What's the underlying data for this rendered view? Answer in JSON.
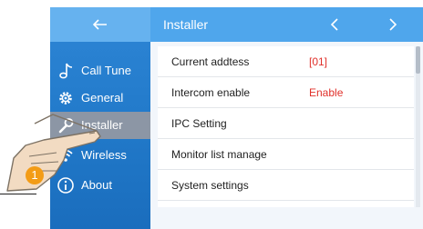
{
  "sidebar": {
    "back_icon": "arrow-left-icon",
    "items": [
      {
        "label": "Call Tune",
        "icon": "music-note-icon"
      },
      {
        "label": "General",
        "icon": "gear-icon"
      },
      {
        "label": "Installer",
        "icon": "wrench-icon",
        "active": true
      },
      {
        "label": "Wireless",
        "icon": "wifi-icon"
      },
      {
        "label": "About",
        "icon": "info-icon"
      }
    ]
  },
  "header": {
    "title": "Installer",
    "prev_icon": "chevron-left-icon",
    "next_icon": "chevron-right-icon"
  },
  "settings": [
    {
      "label": "Current addtess",
      "value": "[01]"
    },
    {
      "label": "Intercom enable",
      "value": "Enable"
    },
    {
      "label": "IPC Setting",
      "value": ""
    },
    {
      "label": "Monitor list manage",
      "value": ""
    },
    {
      "label": "System settings",
      "value": ""
    }
  ],
  "annotation": {
    "step_number": "1",
    "hand_icon": "pointing-hand-icon"
  },
  "colors": {
    "sidebar_blue": "#2179c9",
    "header_blue": "#4fa6ec",
    "active_item": "#8c96a5",
    "value_red": "#e0302a",
    "badge_orange": "#f39c16"
  }
}
